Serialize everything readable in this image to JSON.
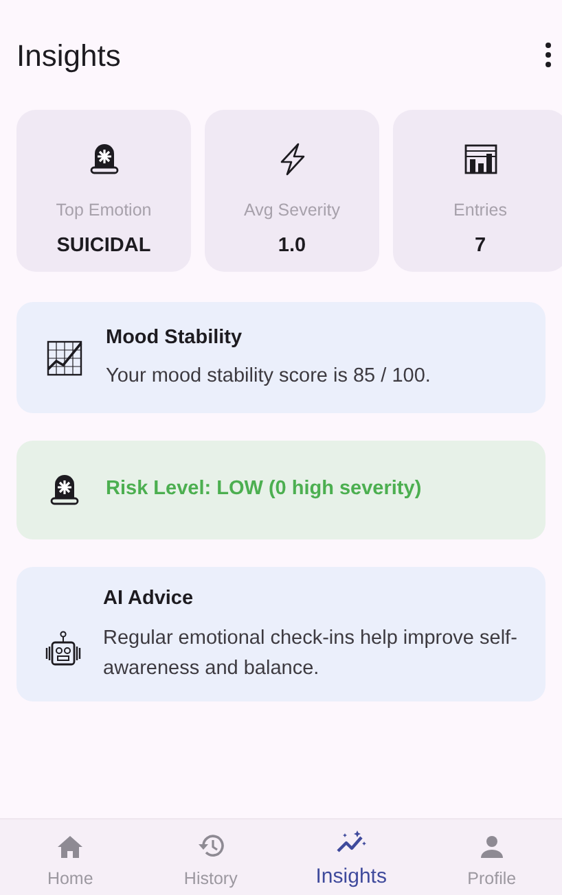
{
  "header": {
    "title": "Insights"
  },
  "stats": [
    {
      "kind": "siren",
      "label": "Top Emotion",
      "value": "SUICIDAL"
    },
    {
      "kind": "bolt",
      "label": "Avg Severity",
      "value": "1.0"
    },
    {
      "kind": "chart",
      "label": "Entries",
      "value": "7"
    }
  ],
  "cards": [
    {
      "kind": "mood",
      "title": "Mood Stability",
      "text": "Your mood stability score is 85 / 100."
    },
    {
      "kind": "risk",
      "text": "Risk Level: LOW (0 high severity)"
    },
    {
      "kind": "advice",
      "title": "AI Advice",
      "text": "Regular emotional check-ins help improve self-awareness and balance."
    }
  ],
  "nav": [
    {
      "kind": "home",
      "label": "Home",
      "selected": false
    },
    {
      "kind": "history",
      "label": "History",
      "selected": false
    },
    {
      "kind": "insights",
      "label": "Insights",
      "selected": true
    },
    {
      "kind": "profile",
      "label": "Profile",
      "selected": false
    }
  ]
}
